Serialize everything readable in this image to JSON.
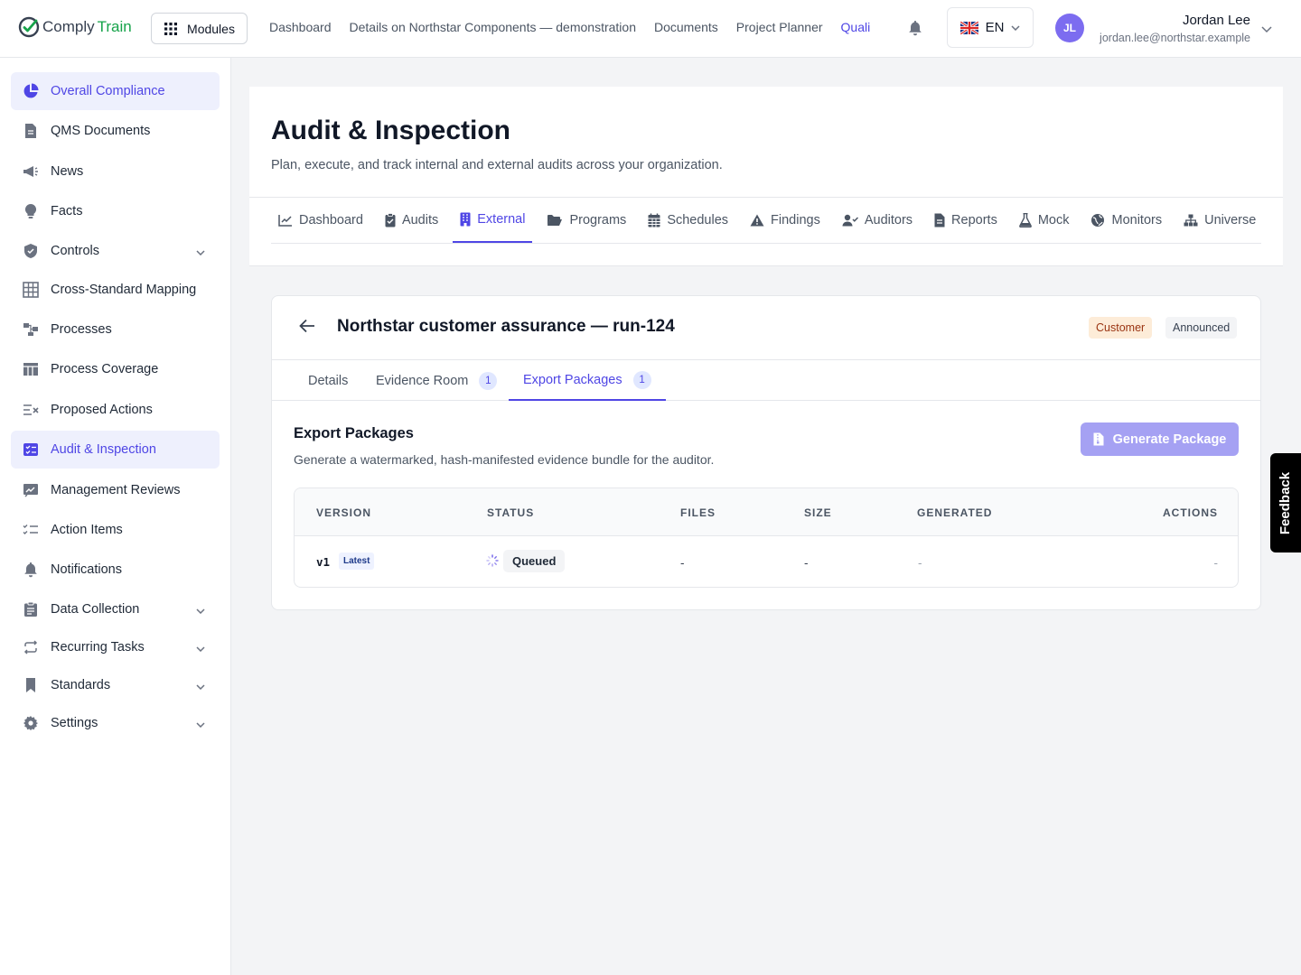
{
  "app": {
    "logo_part1": "Comply",
    "logo_part2": "Train",
    "brand_color": "#16a34a",
    "accent_color": "#4f46e5"
  },
  "topbar": {
    "modules_label": "Modules",
    "nav": [
      "Dashboard",
      "Details on Northstar Components — demonstration",
      "Documents",
      "Project Planner",
      "Quali"
    ],
    "language": "EN",
    "user": {
      "initials": "JL",
      "name": "Jordan Lee",
      "email": "jordan.lee@northstar.example"
    }
  },
  "sidebar": {
    "items": [
      {
        "label": "Overall Compliance",
        "icon": "pie-chart-icon",
        "active": true
      },
      {
        "label": "QMS Documents",
        "icon": "document-icon"
      },
      {
        "label": "News",
        "icon": "megaphone-icon"
      },
      {
        "label": "Facts",
        "icon": "lightbulb-icon"
      },
      {
        "label": "Controls",
        "icon": "shield-icon",
        "expandable": true
      },
      {
        "label": "Cross-Standard Mapping",
        "icon": "grid-icon"
      },
      {
        "label": "Processes",
        "icon": "process-icon"
      },
      {
        "label": "Process Coverage",
        "icon": "table-icon"
      },
      {
        "label": "Proposed Actions",
        "icon": "list-x-icon"
      },
      {
        "label": "Audit & Inspection",
        "icon": "checklist-icon",
        "active": true
      },
      {
        "label": "Management Reviews",
        "icon": "chart-board-icon"
      },
      {
        "label": "Action Items",
        "icon": "list-check-icon"
      },
      {
        "label": "Notifications",
        "icon": "bell-icon"
      },
      {
        "label": "Data Collection",
        "icon": "clipboard-icon",
        "expandable": true
      },
      {
        "label": "Recurring Tasks",
        "icon": "repeat-icon",
        "expandable": true
      },
      {
        "label": "Standards",
        "icon": "bookmark-icon",
        "expandable": true
      },
      {
        "label": "Settings",
        "icon": "gear-icon",
        "expandable": true
      }
    ]
  },
  "page": {
    "title": "Audit & Inspection",
    "subtitle": "Plan, execute, and track internal and external audits across your organization.",
    "tabs": [
      {
        "label": "Dashboard",
        "icon": "line-chart-icon"
      },
      {
        "label": "Audits",
        "icon": "clipboard-check-icon"
      },
      {
        "label": "External",
        "icon": "building-icon",
        "active": true
      },
      {
        "label": "Programs",
        "icon": "folder-open-icon"
      },
      {
        "label": "Schedules",
        "icon": "calendar-icon"
      },
      {
        "label": "Findings",
        "icon": "warning-icon"
      },
      {
        "label": "Auditors",
        "icon": "user-check-icon"
      },
      {
        "label": "Reports",
        "icon": "file-icon"
      },
      {
        "label": "Mock",
        "icon": "flask-icon"
      },
      {
        "label": "Monitors",
        "icon": "globe-icon"
      },
      {
        "label": "Universe",
        "icon": "sitemap-icon"
      }
    ]
  },
  "audit": {
    "title": "Northstar customer assurance — run-124",
    "badges": [
      "Customer",
      "Announced"
    ],
    "subtabs": [
      {
        "label": "Details"
      },
      {
        "label": "Evidence Room",
        "count": "1"
      },
      {
        "label": "Export Packages",
        "count": "1",
        "active": true
      }
    ]
  },
  "export": {
    "title": "Export Packages",
    "subtitle": "Generate a watermarked, hash-manifested evidence bundle for the auditor.",
    "generate_label": "Generate Package",
    "columns": [
      "VERSION",
      "STATUS",
      "FILES",
      "SIZE",
      "GENERATED",
      "ACTIONS"
    ],
    "rows": [
      {
        "version": "v1",
        "tag": "Latest",
        "status": "Queued",
        "files": "-",
        "size": "-",
        "generated": "-",
        "actions": "-"
      }
    ]
  },
  "feedback_label": "Feedback"
}
